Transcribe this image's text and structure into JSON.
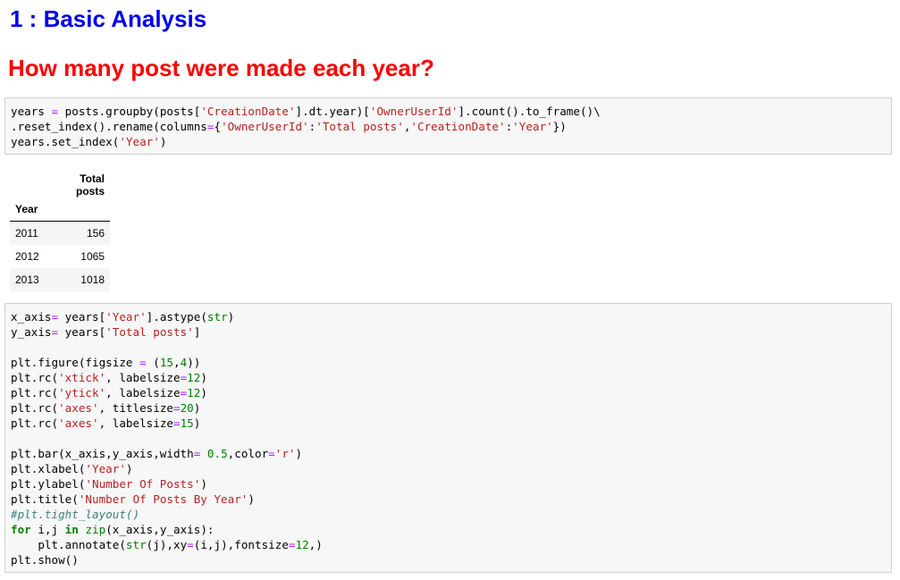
{
  "headings": {
    "h1": "1 : Basic Analysis",
    "h2": "How many post were made each year?"
  },
  "table": {
    "column_header": "Total posts",
    "index_name": "Year",
    "rows": [
      {
        "year": "2011",
        "total": "156"
      },
      {
        "year": "2012",
        "total": "1065"
      },
      {
        "year": "2013",
        "total": "1018"
      }
    ]
  },
  "colors": {
    "h1": "#0000ee",
    "h2": "#ff0000",
    "string": "#ba2121",
    "keyword": "#008000",
    "number": "#008000",
    "operator": "#aa22ff",
    "comment": "#408080"
  },
  "code_cells": {
    "cell1": [
      [
        [
          "t",
          "years "
        ],
        [
          "o",
          "="
        ],
        [
          "t",
          " posts.groupby(posts["
        ],
        [
          "s",
          "'CreationDate'"
        ],
        [
          "t",
          "].dt.year)["
        ],
        [
          "s",
          "'OwnerUserId'"
        ],
        [
          "t",
          "].count().to_frame()\\"
        ]
      ],
      [
        [
          "t",
          ".reset_index().rename(columns"
        ],
        [
          "o",
          "="
        ],
        [
          "t",
          "{"
        ],
        [
          "s",
          "'OwnerUserId'"
        ],
        [
          "t",
          ":"
        ],
        [
          "s",
          "'Total posts'"
        ],
        [
          "t",
          ","
        ],
        [
          "s",
          "'CreationDate'"
        ],
        [
          "t",
          ":"
        ],
        [
          "s",
          "'Year'"
        ],
        [
          "t",
          "})"
        ]
      ],
      [
        [
          "t",
          "years.set_index("
        ],
        [
          "s",
          "'Year'"
        ],
        [
          "t",
          ")"
        ]
      ]
    ],
    "cell2": [
      [
        [
          "t",
          "x_axis"
        ],
        [
          "o",
          "="
        ],
        [
          "t",
          " years["
        ],
        [
          "s",
          "'Year'"
        ],
        [
          "t",
          "].astype("
        ],
        [
          "n",
          "str"
        ],
        [
          "t",
          ")"
        ]
      ],
      [
        [
          "t",
          "y_axis"
        ],
        [
          "o",
          "="
        ],
        [
          "t",
          " years["
        ],
        [
          "s",
          "'Total posts'"
        ],
        [
          "t",
          "]"
        ]
      ],
      [],
      [
        [
          "t",
          "plt.figure(figsize "
        ],
        [
          "o",
          "="
        ],
        [
          "t",
          " ("
        ],
        [
          "n",
          "15"
        ],
        [
          "t",
          ","
        ],
        [
          "n",
          "4"
        ],
        [
          "t",
          "))"
        ]
      ],
      [
        [
          "t",
          "plt.rc("
        ],
        [
          "s",
          "'xtick'"
        ],
        [
          "t",
          ", labelsize"
        ],
        [
          "o",
          "="
        ],
        [
          "n",
          "12"
        ],
        [
          "t",
          ")"
        ]
      ],
      [
        [
          "t",
          "plt.rc("
        ],
        [
          "s",
          "'ytick'"
        ],
        [
          "t",
          ", labelsize"
        ],
        [
          "o",
          "="
        ],
        [
          "n",
          "12"
        ],
        [
          "t",
          ")"
        ]
      ],
      [
        [
          "t",
          "plt.rc("
        ],
        [
          "s",
          "'axes'"
        ],
        [
          "t",
          ", titlesize"
        ],
        [
          "o",
          "="
        ],
        [
          "n",
          "20"
        ],
        [
          "t",
          ")"
        ]
      ],
      [
        [
          "t",
          "plt.rc("
        ],
        [
          "s",
          "'axes'"
        ],
        [
          "t",
          ", labelsize"
        ],
        [
          "o",
          "="
        ],
        [
          "n",
          "15"
        ],
        [
          "t",
          ")"
        ]
      ],
      [],
      [
        [
          "t",
          "plt.bar(x_axis,y_axis,width"
        ],
        [
          "o",
          "="
        ],
        [
          "t",
          " "
        ],
        [
          "n",
          "0.5"
        ],
        [
          "t",
          ",color"
        ],
        [
          "o",
          "="
        ],
        [
          "s",
          "'r'"
        ],
        [
          "t",
          ")"
        ]
      ],
      [
        [
          "t",
          "plt.xlabel("
        ],
        [
          "s",
          "'Year'"
        ],
        [
          "t",
          ")"
        ]
      ],
      [
        [
          "t",
          "plt.ylabel("
        ],
        [
          "s",
          "'Number Of Posts'"
        ],
        [
          "t",
          ")"
        ]
      ],
      [
        [
          "t",
          "plt.title("
        ],
        [
          "s",
          "'Number Of Posts By Year'"
        ],
        [
          "t",
          ")"
        ]
      ],
      [
        [
          "c",
          "#plt.tight_layout()"
        ]
      ],
      [
        [
          "k",
          "for"
        ],
        [
          "t",
          " i,j "
        ],
        [
          "k",
          "in"
        ],
        [
          "t",
          " "
        ],
        [
          "n",
          "zip"
        ],
        [
          "t",
          "(x_axis,y_axis):"
        ]
      ],
      [
        [
          "t",
          "    plt.annotate("
        ],
        [
          "n",
          "str"
        ],
        [
          "t",
          "(j),xy"
        ],
        [
          "o",
          "="
        ],
        [
          "t",
          "(i,j),fontsize"
        ],
        [
          "o",
          "="
        ],
        [
          "n",
          "12"
        ],
        [
          "t",
          ",)"
        ]
      ],
      [
        [
          "t",
          "plt.show()"
        ]
      ]
    ]
  }
}
